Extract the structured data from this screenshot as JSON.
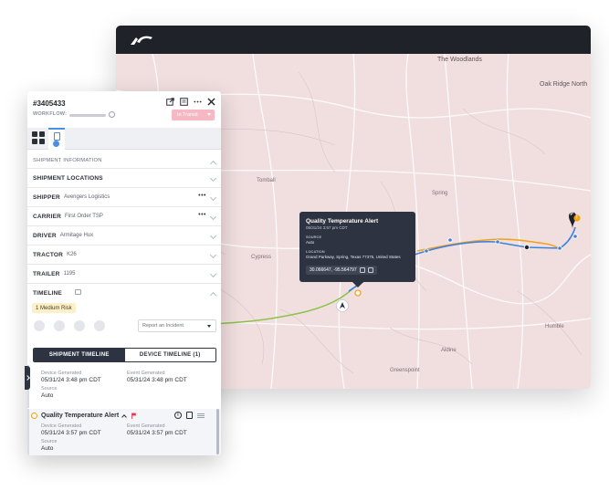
{
  "map": {
    "places": [
      {
        "name": "The Woodlands"
      },
      {
        "name": "Oak Ridge North"
      },
      {
        "name": "Tomball"
      },
      {
        "name": "Cypress"
      },
      {
        "name": "Spring"
      },
      {
        "name": "Humble"
      },
      {
        "name": "Aldine"
      },
      {
        "name": "Greenspoint"
      }
    ],
    "pin_label": "P",
    "marker_label": "!",
    "tooltip": {
      "title": "Quality Temperature Alert",
      "time": "05/31/24 3:57 pm CDT",
      "source_label": "SOURCE",
      "source_value": "Auto",
      "location_label": "LOCATION",
      "location_value": "Grand Parkway, Spring, Texas 77375, United States",
      "coords": "30.066647, -95.564797"
    },
    "colors": {
      "route_green": "#8bc34a",
      "route_blue": "#3b82e0",
      "route_orange": "#f0a21b",
      "map_bg": "#f1dfe0"
    }
  },
  "panel": {
    "shipment_id": "#3405433",
    "workflow_label": "WORKFLOW:",
    "status": "In Transit",
    "status_color": "#f6b8c3",
    "sections": {
      "shipment_information": "SHIPMENT INFORMATION",
      "shipment_locations": "SHIPMENT LOCATIONS",
      "shipper_label": "SHIPPER",
      "shipper_value": "Avengers Logistics",
      "carrier_label": "CARRIER",
      "carrier_value": "First Order TSP",
      "driver_label": "DRIVER",
      "driver_value": "Armitage Hux",
      "tractor_label": "TRACTOR",
      "tractor_value": "K26",
      "trailer_label": "TRAILER",
      "trailer_value": "1195",
      "timeline_label": "TIMELINE"
    },
    "risk": "1 Medium Risk",
    "report_placeholder": "Report an Incident",
    "tabs": {
      "shipment": "SHIPMENT TIMELINE",
      "device": "DEVICE TIMELINE (1)"
    },
    "events": [
      {
        "device_label": "Device Generated",
        "device_time": "05/31/24 3:48 pm CDT",
        "event_label": "Event Generated",
        "event_time": "05/31/24 3:48 pm CDT",
        "source_label": "Source",
        "source_value": "Auto"
      },
      {
        "title": "Quality Temperature Alert",
        "device_label": "Device Generated",
        "device_time": "05/31/24 3:57 pm CDT",
        "event_label": "Event Generated",
        "event_time": "05/31/24 3:57 pm CDT",
        "source_label": "Source",
        "source_value": "Auto"
      }
    ],
    "icons": [
      "external-link-icon",
      "print-icon",
      "more-icon",
      "close-icon",
      "grid-icon",
      "truck-icon",
      "comment-icon",
      "flag-icon",
      "info-icon",
      "clipboard-icon",
      "menu-lines-icon"
    ]
  }
}
